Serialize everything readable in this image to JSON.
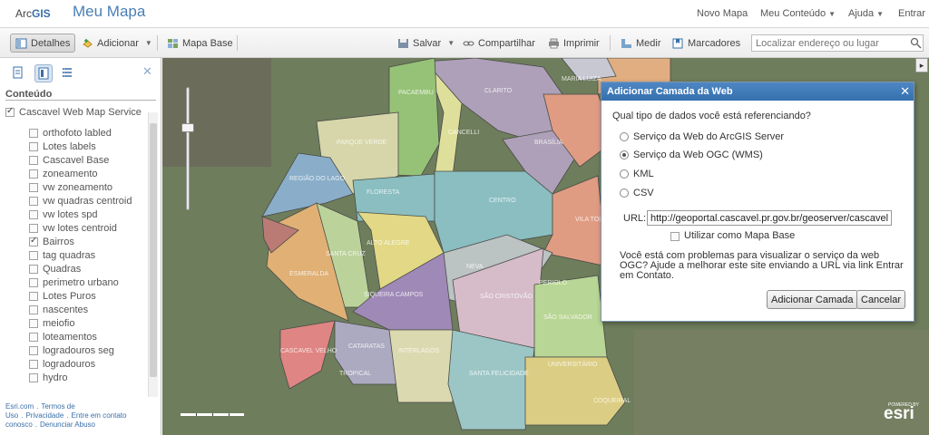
{
  "app": {
    "brand_prefix": "Arc",
    "brand_suffix": "GIS",
    "map_title": "Meu Mapa"
  },
  "topnav": [
    {
      "label": "Novo Mapa",
      "dropdown": false
    },
    {
      "label": "Meu Conteúdo",
      "dropdown": true
    },
    {
      "label": "Ajuda",
      "dropdown": true
    },
    {
      "label": "Entrar",
      "dropdown": false
    }
  ],
  "toolbar": {
    "details": "Detalhes",
    "add": "Adicionar",
    "basemap": "Mapa Base",
    "save": "Salvar",
    "share": "Compartilhar",
    "print": "Imprimir",
    "measure": "Medir",
    "bookmarks": "Marcadores",
    "search_placeholder": "Localizar endereço ou lugar"
  },
  "sidebar": {
    "heading": "Conteúdo",
    "root_layer": {
      "label": "Cascavel Web Map Service",
      "checked": true
    },
    "layers": [
      {
        "label": "orthofoto labled",
        "checked": false
      },
      {
        "label": "Lotes labels",
        "checked": false
      },
      {
        "label": "Cascavel Base",
        "checked": false
      },
      {
        "label": "zoneamento",
        "checked": false
      },
      {
        "label": "vw zoneamento",
        "checked": false
      },
      {
        "label": "vw quadras centroid",
        "checked": false
      },
      {
        "label": "vw lotes spd",
        "checked": false
      },
      {
        "label": "vw lotes centroid",
        "checked": false
      },
      {
        "label": "Bairros",
        "checked": true
      },
      {
        "label": "tag quadras",
        "checked": false
      },
      {
        "label": "Quadras",
        "checked": false
      },
      {
        "label": "perimetro urbano",
        "checked": false
      },
      {
        "label": "Lotes Puros",
        "checked": false
      },
      {
        "label": "nascentes",
        "checked": false
      },
      {
        "label": "meiofio",
        "checked": false
      },
      {
        "label": "loteamentos",
        "checked": false
      },
      {
        "label": "logradouros seg",
        "checked": false
      },
      {
        "label": "logradouros",
        "checked": false
      },
      {
        "label": "hydro",
        "checked": false
      }
    ],
    "footer": [
      "Esri.com",
      ".",
      "Termos de Uso",
      ".",
      "Privacidade",
      ".",
      "Entre em contato conosco",
      ".",
      "Denunciar Abuso"
    ]
  },
  "map": {
    "neighborhoods": [
      "CANCELLI",
      "PARQUE VERDE",
      "CENTRO",
      "ALTO ALEGRE",
      "SANTA CRUZ",
      "NEVA",
      "UNIVERSITÁRIO",
      "SANTA FELICIDADE",
      "SIQUEIRA CAMPOS",
      "SÃO CRISTÓVÃO",
      "CATARATAS",
      "FLORESTA",
      "INTERLAGOS",
      "BRASÍLIA",
      "ESMERALDA",
      "PERIOLO",
      "MARIA LUIZA",
      "CASCAVEL VELHO",
      "REGIÃO DO LAGO",
      "VILA TOLEDO",
      "PACAEMBU",
      "COQUEIRAL",
      "TROPICAL",
      "SÃO SALVADOR",
      "CLARITO"
    ],
    "attribution": [
      "POWERED BY",
      "esri"
    ],
    "colors": {
      "dialog_header": "#3f7dbd",
      "link": "#3a6fa8"
    }
  },
  "dialog": {
    "title": "Adicionar Camada da Web",
    "question": "Qual tipo de dados você está referenciando?",
    "options": [
      {
        "label": "Serviço da Web do ArcGIS Server",
        "selected": false
      },
      {
        "label": "Serviço da Web OGC (WMS)",
        "selected": true
      },
      {
        "label": "KML",
        "selected": false
      },
      {
        "label": "CSV",
        "selected": false
      }
    ],
    "url_label": "URL:",
    "url_value": "http://geoportal.cascavel.pr.gov.br/geoserver/cascavel/",
    "use_as_basemap": "Utilizar como Mapa Base",
    "help_text": "Você está com problemas para visualizar o serviço da web OGC? Ajude a melhorar este site enviando a URL via link Entrar em Contato.",
    "add_button": "Adicionar Camada",
    "cancel_button": "Cancelar"
  }
}
